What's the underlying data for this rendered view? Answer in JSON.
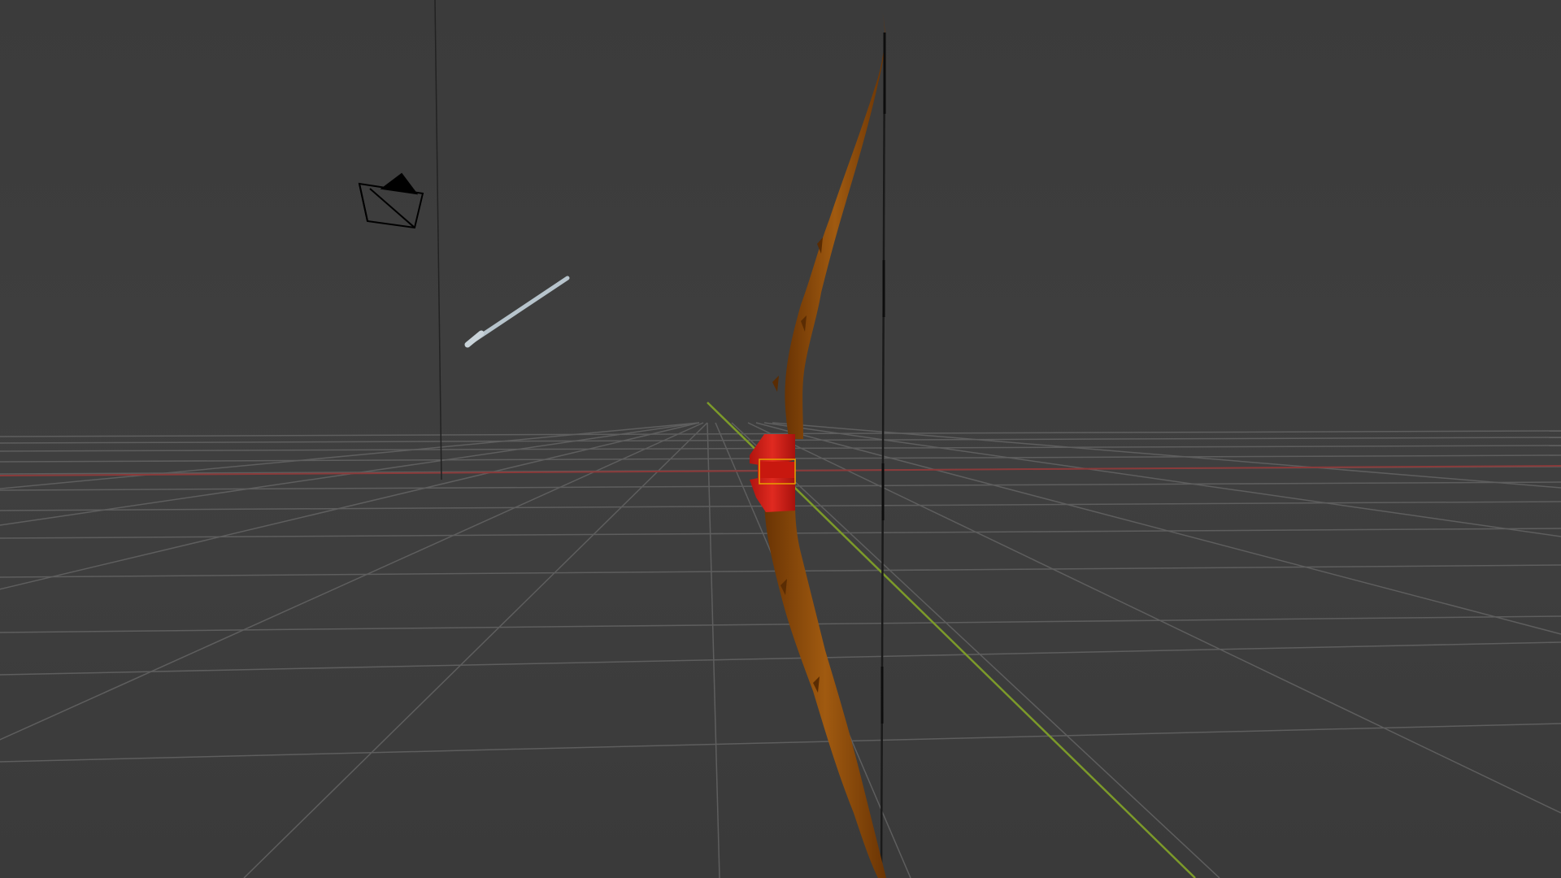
{
  "viewport": {
    "mode": "3d-viewport",
    "background_color": "#3d3d3d",
    "horizon_color": "#404040"
  },
  "scene": {
    "objects": [
      {
        "name": "camera",
        "kind": "camera-wireframe",
        "color": "#000000"
      },
      {
        "name": "light",
        "kind": "light-gizmo",
        "color": "#000000"
      },
      {
        "name": "arrow",
        "kind": "mesh",
        "color": "#b7c4cc"
      },
      {
        "name": "bow",
        "kind": "mesh",
        "limb_color": "#7a3d06",
        "limb_highlight": "#a05a10",
        "grip_color": "#d6201a"
      },
      {
        "name": "bow-string",
        "kind": "mesh",
        "color": "#1a1a1a"
      }
    ],
    "axes": {
      "x_axis_color": "#8a3a3a",
      "y_axis_color": "#7c9a2a"
    },
    "grid": {
      "shown": true,
      "line_color": "#5e5e5e"
    },
    "selection_outline_color": "#e8a000"
  }
}
